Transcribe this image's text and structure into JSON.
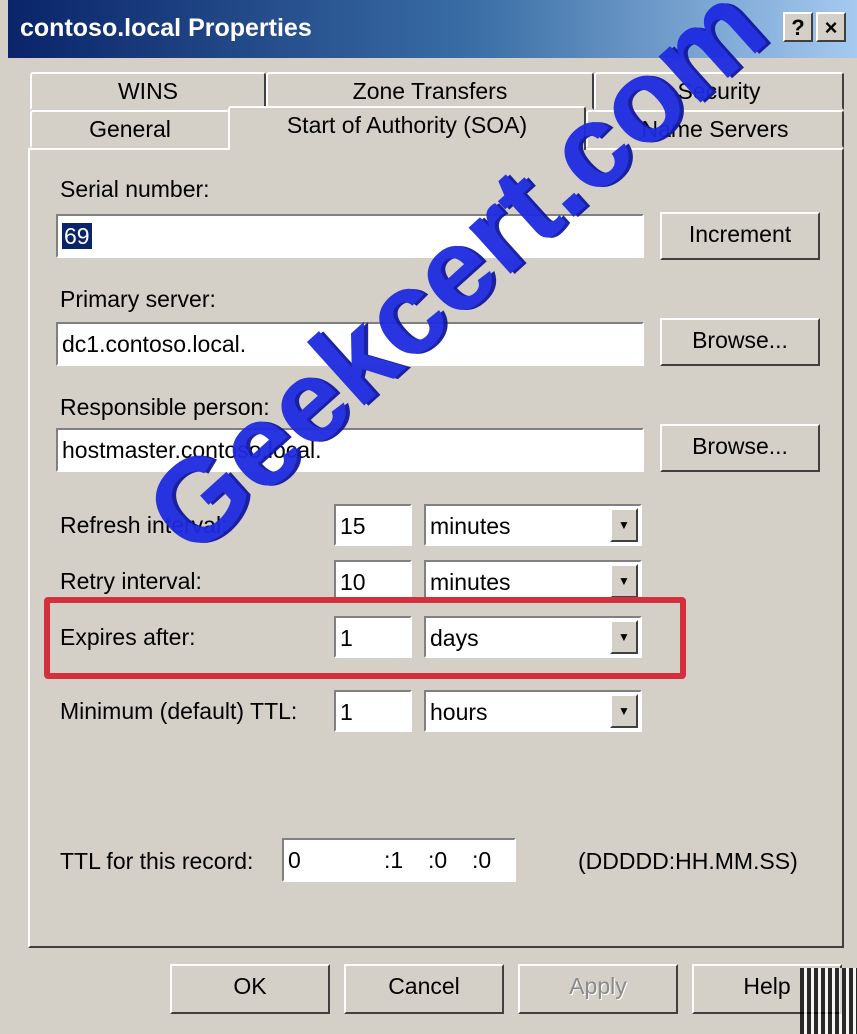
{
  "window": {
    "title": "contoso.local Properties",
    "help_label": "?",
    "close_label": "×"
  },
  "tabs": {
    "row_back": [
      "WINS",
      "Zone Transfers",
      "Security"
    ],
    "row_front": [
      "General",
      "Start of Authority (SOA)",
      "Name Servers"
    ],
    "active": "Start of Authority (SOA)"
  },
  "soa": {
    "serial_label": "Serial number:",
    "serial_value": "69",
    "increment_label": "Increment",
    "primary_label": "Primary server:",
    "primary_value": "dc1.contoso.local.",
    "browse_label": "Browse...",
    "responsible_label": "Responsible person:",
    "responsible_value": "hostmaster.contoso.local.",
    "refresh_label": "Refresh interval:",
    "refresh_value": "15",
    "refresh_unit": "minutes",
    "retry_label": "Retry interval:",
    "retry_value": "10",
    "retry_unit": "minutes",
    "expires_label": "Expires after:",
    "expires_value": "1",
    "expires_unit": "days",
    "min_ttl_label": "Minimum (default) TTL:",
    "min_ttl_value": "1",
    "min_ttl_unit": "hours",
    "ttl_record_label": "TTL for this record:",
    "ttl_days": "0",
    "ttl_hours": ":1",
    "ttl_minutes": ":0",
    "ttl_seconds": ":0",
    "ttl_format": "(DDDDD:HH.MM.SS)"
  },
  "buttons": {
    "ok": "OK",
    "cancel": "Cancel",
    "apply": "Apply",
    "help": "Help"
  },
  "watermark": "Geekcert.com",
  "colors": {
    "title_bar": "#0a246a",
    "highlight": "#d32f3c",
    "watermark": "#1e2be0",
    "face": "#d4d0c8"
  }
}
